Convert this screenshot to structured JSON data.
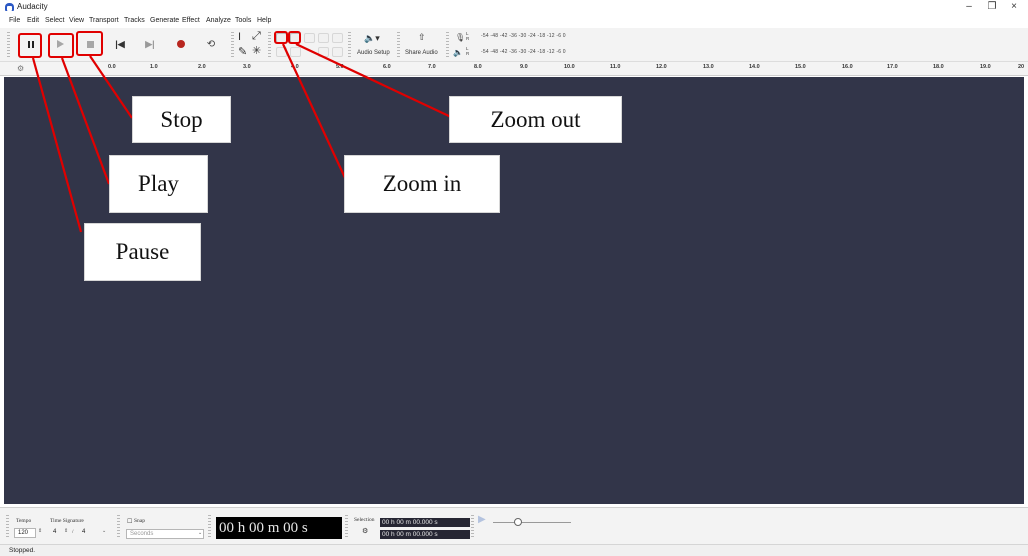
{
  "window": {
    "title": "Audacity",
    "minimize": "–",
    "restore": "❐",
    "close": "×"
  },
  "menu": [
    "File",
    "Edit",
    "Select",
    "View",
    "Transport",
    "Tracks",
    "Generate",
    "Effect",
    "Analyze",
    "Tools",
    "Help"
  ],
  "toolbar": {
    "audio_setup": "Audio Setup",
    "share_audio": "Share Audio",
    "meter_record_scale": "-54  -48  -42  -36  -30  -24  -18  -12   -6    0",
    "meter_play_scale": "-54  -48  -42  -36  -30  -24  -18  -12   -6    0",
    "meter_record_lr": "L\nR",
    "meter_play_lr": "L\nR"
  },
  "icons": {
    "pause": "pause-icon",
    "play": "play-icon",
    "stop": "stop-icon",
    "skip_start": "skip-start-icon",
    "skip_end": "skip-end-icon",
    "record": "record-icon",
    "loop": "loop-icon",
    "microphone": "microphone-icon",
    "speaker": "speaker-icon",
    "share": "share-icon"
  },
  "ruler": {
    "labels": [
      "0.0",
      "1.0",
      "2.0",
      "3.0",
      "4.0",
      "5.0",
      "6.0",
      "7.0",
      "8.0",
      "9.0",
      "10.0",
      "11.0",
      "12.0",
      "13.0",
      "14.0",
      "15.0",
      "16.0",
      "17.0",
      "18.0",
      "19.0",
      "20"
    ]
  },
  "callouts": {
    "stop": "Stop",
    "zoom_out": "Zoom out",
    "play": "Play",
    "zoom_in": "Zoom in",
    "pause": "Pause"
  },
  "bottom": {
    "tempo_label": "Tempo",
    "tempo_value": "120",
    "time_sig_label": "Time Signature",
    "time_sig_num": "4",
    "time_sig_den": "4",
    "snap_label": "Snap",
    "snap_unit": "Seconds",
    "time_display": "00 h 00 m 00 s",
    "selection_label": "Selection",
    "selection_start": "00 h 00 m 00.000 s",
    "selection_end": "00 h 00 m 00.000 s"
  },
  "status": {
    "text": "Stopped."
  },
  "colors": {
    "track_bg": "#323549",
    "highlight": "#e00000",
    "record": "#b8261f"
  }
}
